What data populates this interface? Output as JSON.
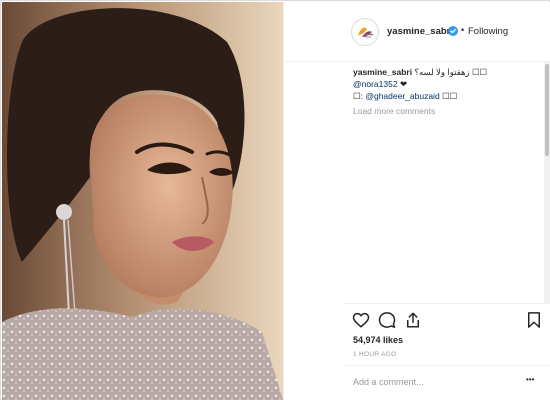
{
  "post": {
    "username": "yasmine_sabri",
    "follow_state": "Following",
    "separator": "•",
    "caption": {
      "text": "زهقتوا ولا لسه؟ ☐☐",
      "line2_mention": "@nora1352",
      "line2_heart": "❤",
      "line3_prefix": "☐: ",
      "line3_mention": "@ghadeer_abuzaid",
      "line3_suffix": " ☐☐"
    },
    "load_more": "Load more comments",
    "likes": "54,974 likes",
    "time": "1 HOUR AGO",
    "comment_placeholder": "Add a comment...",
    "more_options": "•••",
    "avatar_icon": "brand-logo-icon",
    "icons": [
      "heart-icon",
      "comment-icon",
      "share-icon",
      "bookmark-icon",
      "verified-badge-icon"
    ],
    "colors": {
      "link": "#003569",
      "muted": "#999999",
      "verified": "#3897f0"
    }
  }
}
